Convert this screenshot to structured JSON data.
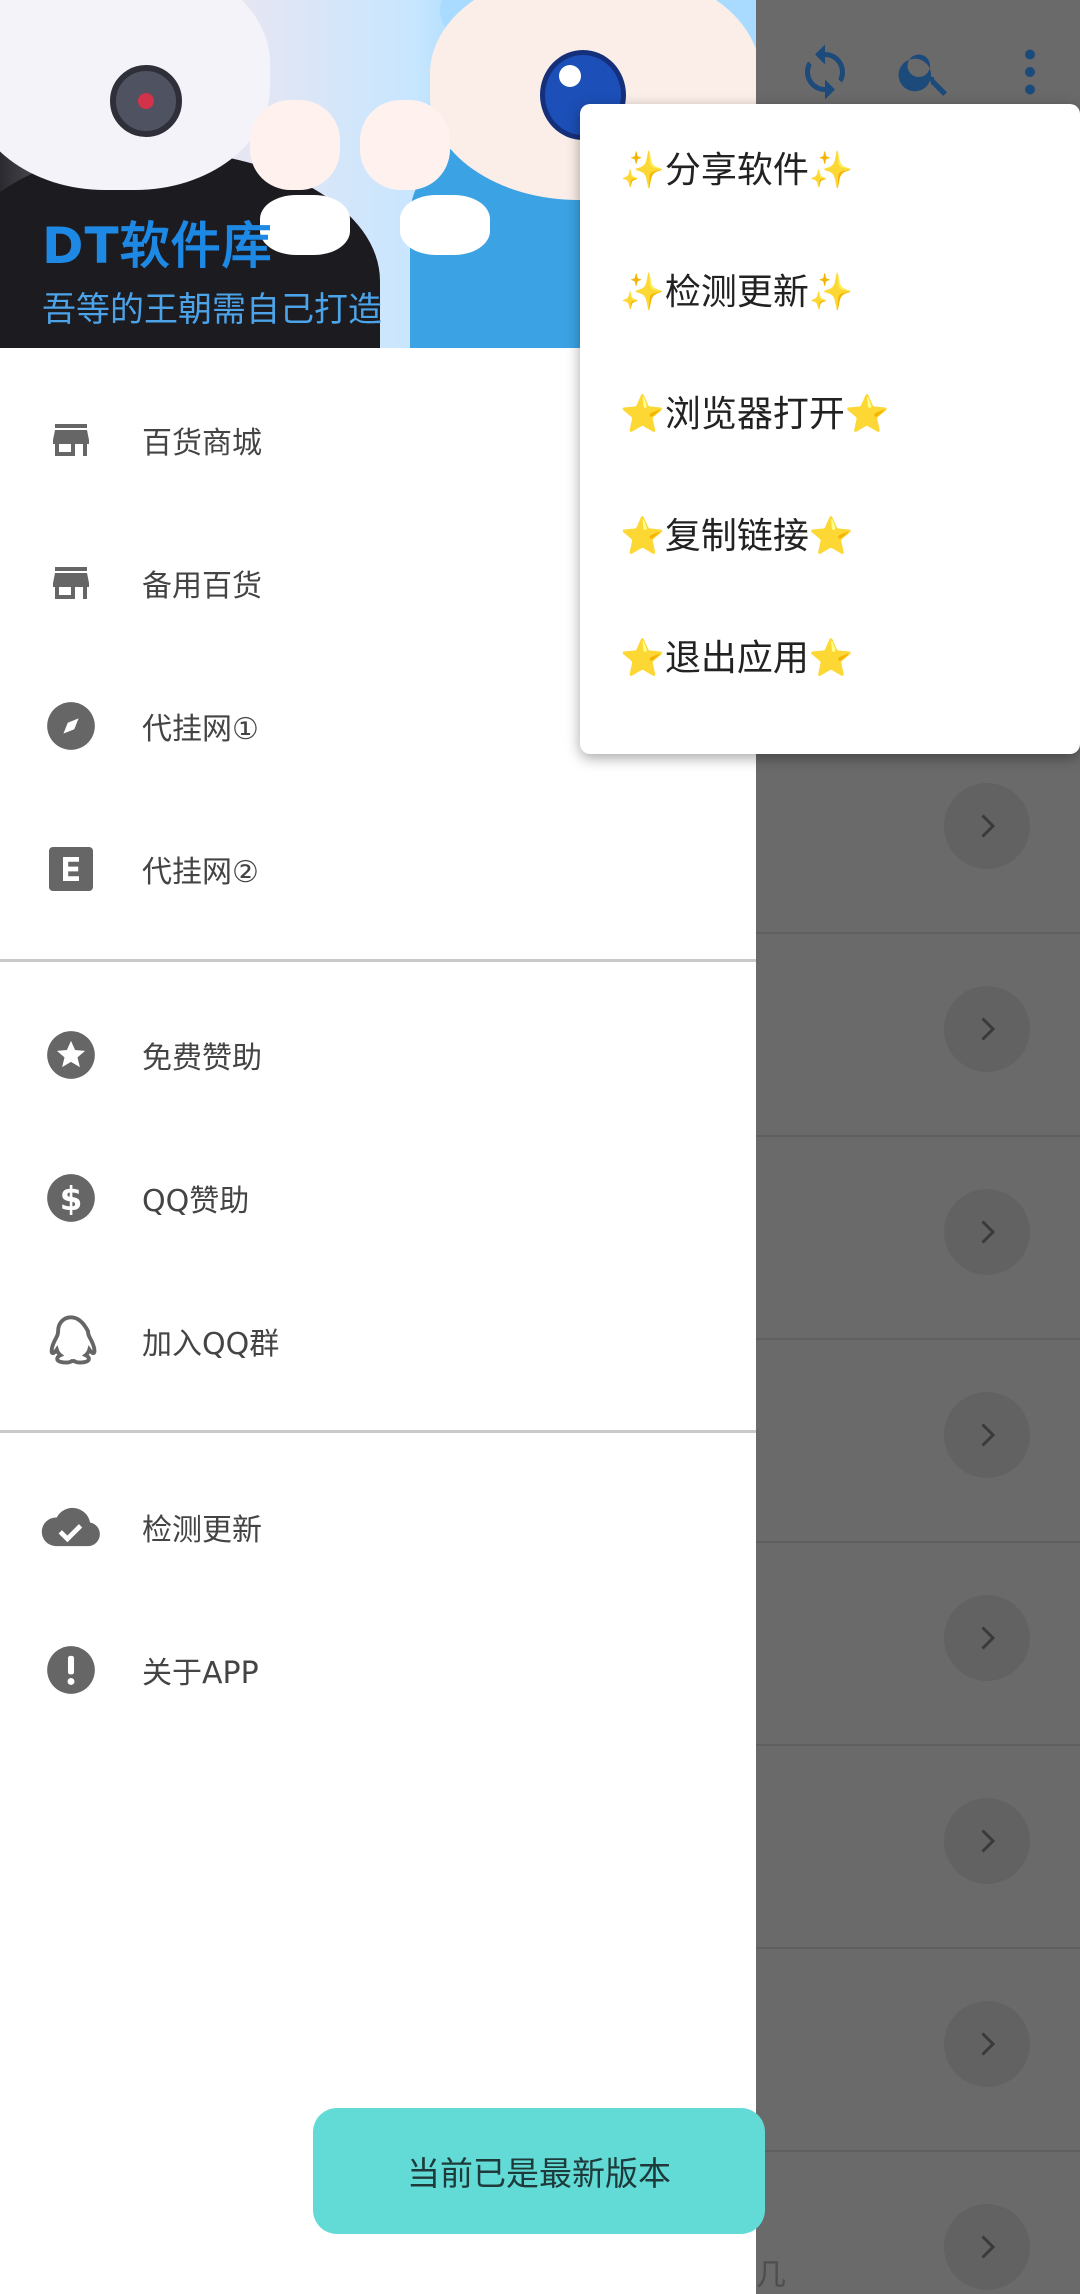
{
  "drawer": {
    "title": "DT软件库",
    "subtitle": "吾等的王朝需自己打造",
    "groups": [
      [
        {
          "icon": "store-icon",
          "label": "百货商城"
        },
        {
          "icon": "store-icon",
          "label": "备用百货"
        },
        {
          "icon": "compass-icon",
          "label": "代挂网①"
        },
        {
          "icon": "e-box-icon",
          "label": "代挂网②"
        }
      ],
      [
        {
          "icon": "star-circle-icon",
          "label": "免费赞助"
        },
        {
          "icon": "dollar-circle-icon",
          "label": "QQ赞助"
        },
        {
          "icon": "qq-penguin-icon",
          "label": "加入QQ群"
        }
      ],
      [
        {
          "icon": "cloud-check-icon",
          "label": "检测更新"
        },
        {
          "icon": "exclamation-circle-icon",
          "label": "关于APP"
        }
      ]
    ]
  },
  "overflow_menu": {
    "items": [
      "✨分享软件✨",
      "✨检测更新✨",
      "⭐浏览器打开⭐",
      "⭐复制链接⭐",
      "⭐退出应用⭐"
    ]
  },
  "toolbar": {
    "icons": [
      "refresh-icon",
      "search-icon",
      "more-vert-icon"
    ]
  },
  "toast": {
    "text": "当前已是最新版本"
  },
  "background": {
    "fragment": "几"
  },
  "colors": {
    "accent": "#1e88e5",
    "toast": "#62dbd7",
    "scrim": "#6a6a6a",
    "icon_gray": "#666666"
  }
}
